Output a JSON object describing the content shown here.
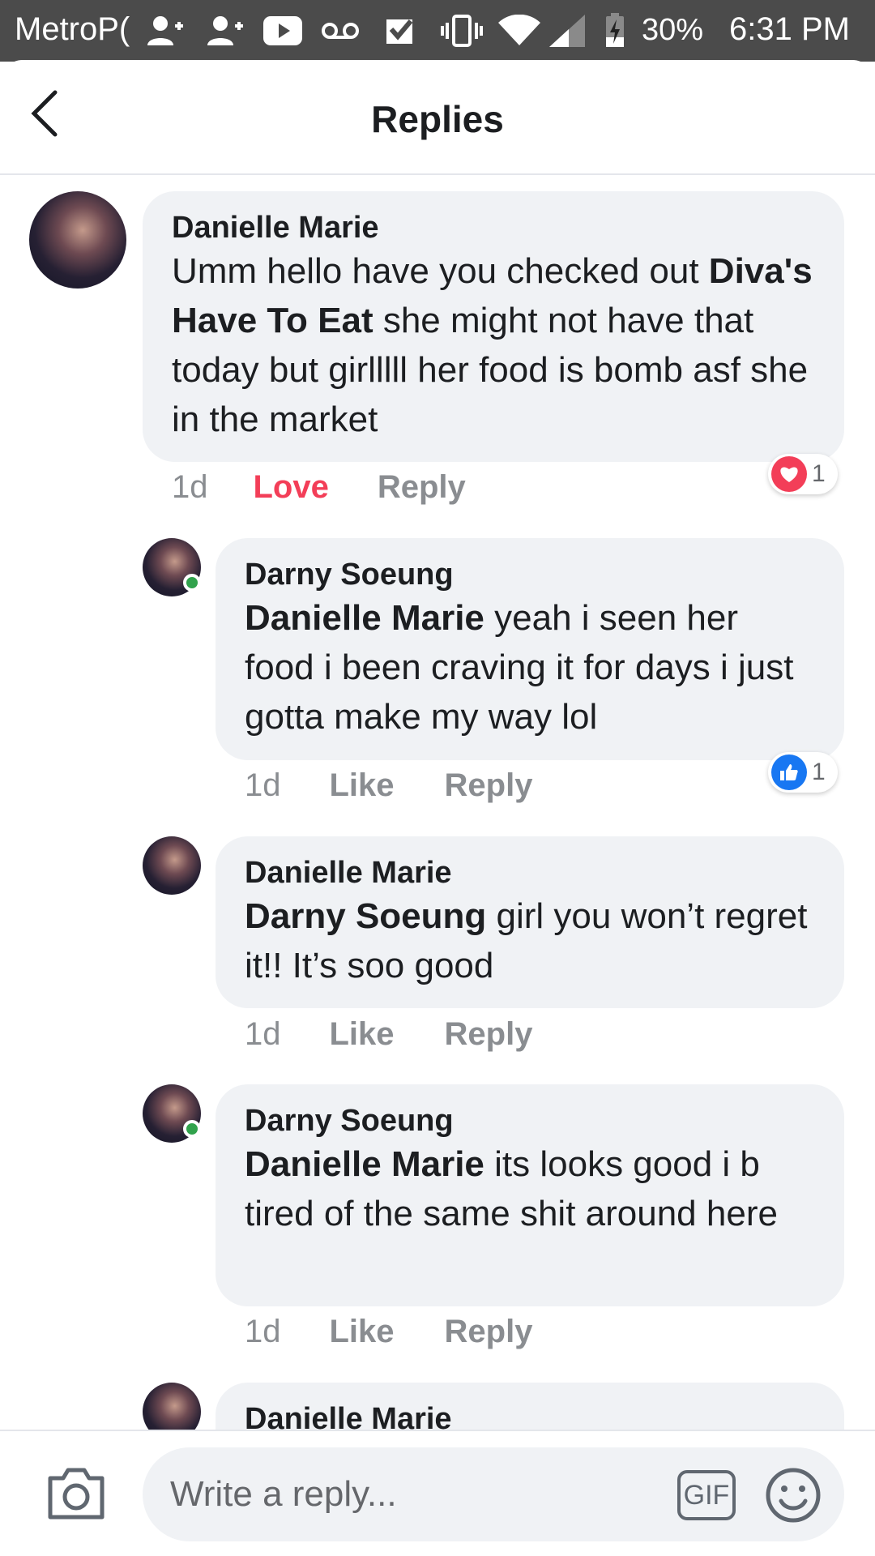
{
  "status_bar": {
    "carrier": "MetroP(",
    "battery": "30%",
    "time": "6:31 PM",
    "icons": [
      "person-add-icon",
      "person-add-icon",
      "youtube-icon",
      "voicemail-icon",
      "check-app-icon",
      "vibrate-icon",
      "wifi-icon",
      "signal-icon",
      "battery-charging-icon"
    ]
  },
  "header": {
    "title": "Replies",
    "back_icon": "chevron-left-icon"
  },
  "comments": [
    {
      "author": "Danielle Marie",
      "mention": "",
      "text_before": "Umm hello have you checked out ",
      "bold": "Diva's Have To Eat",
      "text_after": " she might not have that today but girlllll her food is bomb asf she in the market",
      "time": "1d",
      "reaction_action": "Love",
      "reply_label": "Reply",
      "reaction": {
        "type": "love-icon",
        "count": "1"
      },
      "online": false
    },
    {
      "author": "Darny Soeung",
      "mention": "Danielle Marie",
      "text": " yeah i seen her food i been craving it for days i just gotta make my way lol",
      "time": "1d",
      "like_label": "Like",
      "reply_label": "Reply",
      "reaction": {
        "type": "like-icon",
        "count": "1"
      },
      "online": true
    },
    {
      "author": "Danielle Marie",
      "mention": "Darny Soeung",
      "text": " girl you won’t regret it!! It’s soo good",
      "time": "1d",
      "like_label": "Like",
      "reply_label": "Reply",
      "online": false
    },
    {
      "author": "Darny Soeung",
      "mention": "Danielle Marie",
      "text": " its looks good i b tired of the same shit around here",
      "time": "1d",
      "like_label": "Like",
      "reply_label": "Reply",
      "online": true
    },
    {
      "author": "Danielle Marie",
      "online": false
    }
  ],
  "composer": {
    "placeholder": "Write a reply...",
    "gif_label": "GIF",
    "camera_icon": "camera-icon",
    "emoji_icon": "smiley-icon"
  },
  "colors": {
    "love": "#f33e58",
    "like": "#1877f2",
    "bubble": "#f0f2f5",
    "meta": "#8a8d91",
    "online": "#31a24c"
  }
}
